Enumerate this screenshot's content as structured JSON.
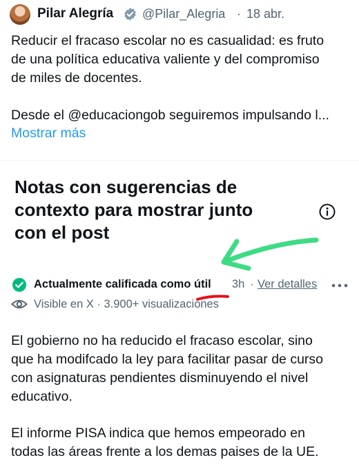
{
  "tweet": {
    "author_name": "Pilar Alegría",
    "handle": "@Pilar_Alegria",
    "separator": "·",
    "date": "18 abr.",
    "text_lines": [
      "Reducir el fracaso escolar no es casualidad: es fruto",
      "de una política educativa valiente y del compromiso",
      "de miles de docentes.",
      "",
      "Desde el @educaciongob seguiremos impulsando l..."
    ],
    "show_more": "Mostrar más"
  },
  "notes": {
    "title_lines": [
      "Notas con sugerencias de",
      "contexto para mostrar junto",
      "con el post"
    ],
    "status": "Actualmente calificada como útil",
    "time": "3h",
    "separator": "·",
    "details_link": "Ver detalles",
    "visibility": "Visible en X · 3.900+ visualizaciones",
    "paragraph1_lines": [
      "El gobierno no ha reducido el fracaso escolar, sino",
      "que ha modifcado la ley para facilitar pasar de curso",
      "con asignaturas pendientes disminuyendo el nivel",
      "educativo."
    ],
    "paragraph2_lines": [
      "El informe PISA indica que hemos empeorado en",
      "todas las áreas frente a los demas paises de la UE."
    ]
  },
  "icons": {
    "verified": "verified-badge-icon",
    "info": "info-icon",
    "check": "check-circle-icon",
    "more": "more-horizontal-icon",
    "eye": "eye-icon"
  },
  "colors": {
    "text": "#0f1419",
    "secondary_text": "#536471",
    "link_blue": "#1d9bf0",
    "verified_gray": "#829aab",
    "check_green": "#00ba7c",
    "annotation_arrow": "#3ddc84",
    "annotation_underline": "#e8101a"
  }
}
